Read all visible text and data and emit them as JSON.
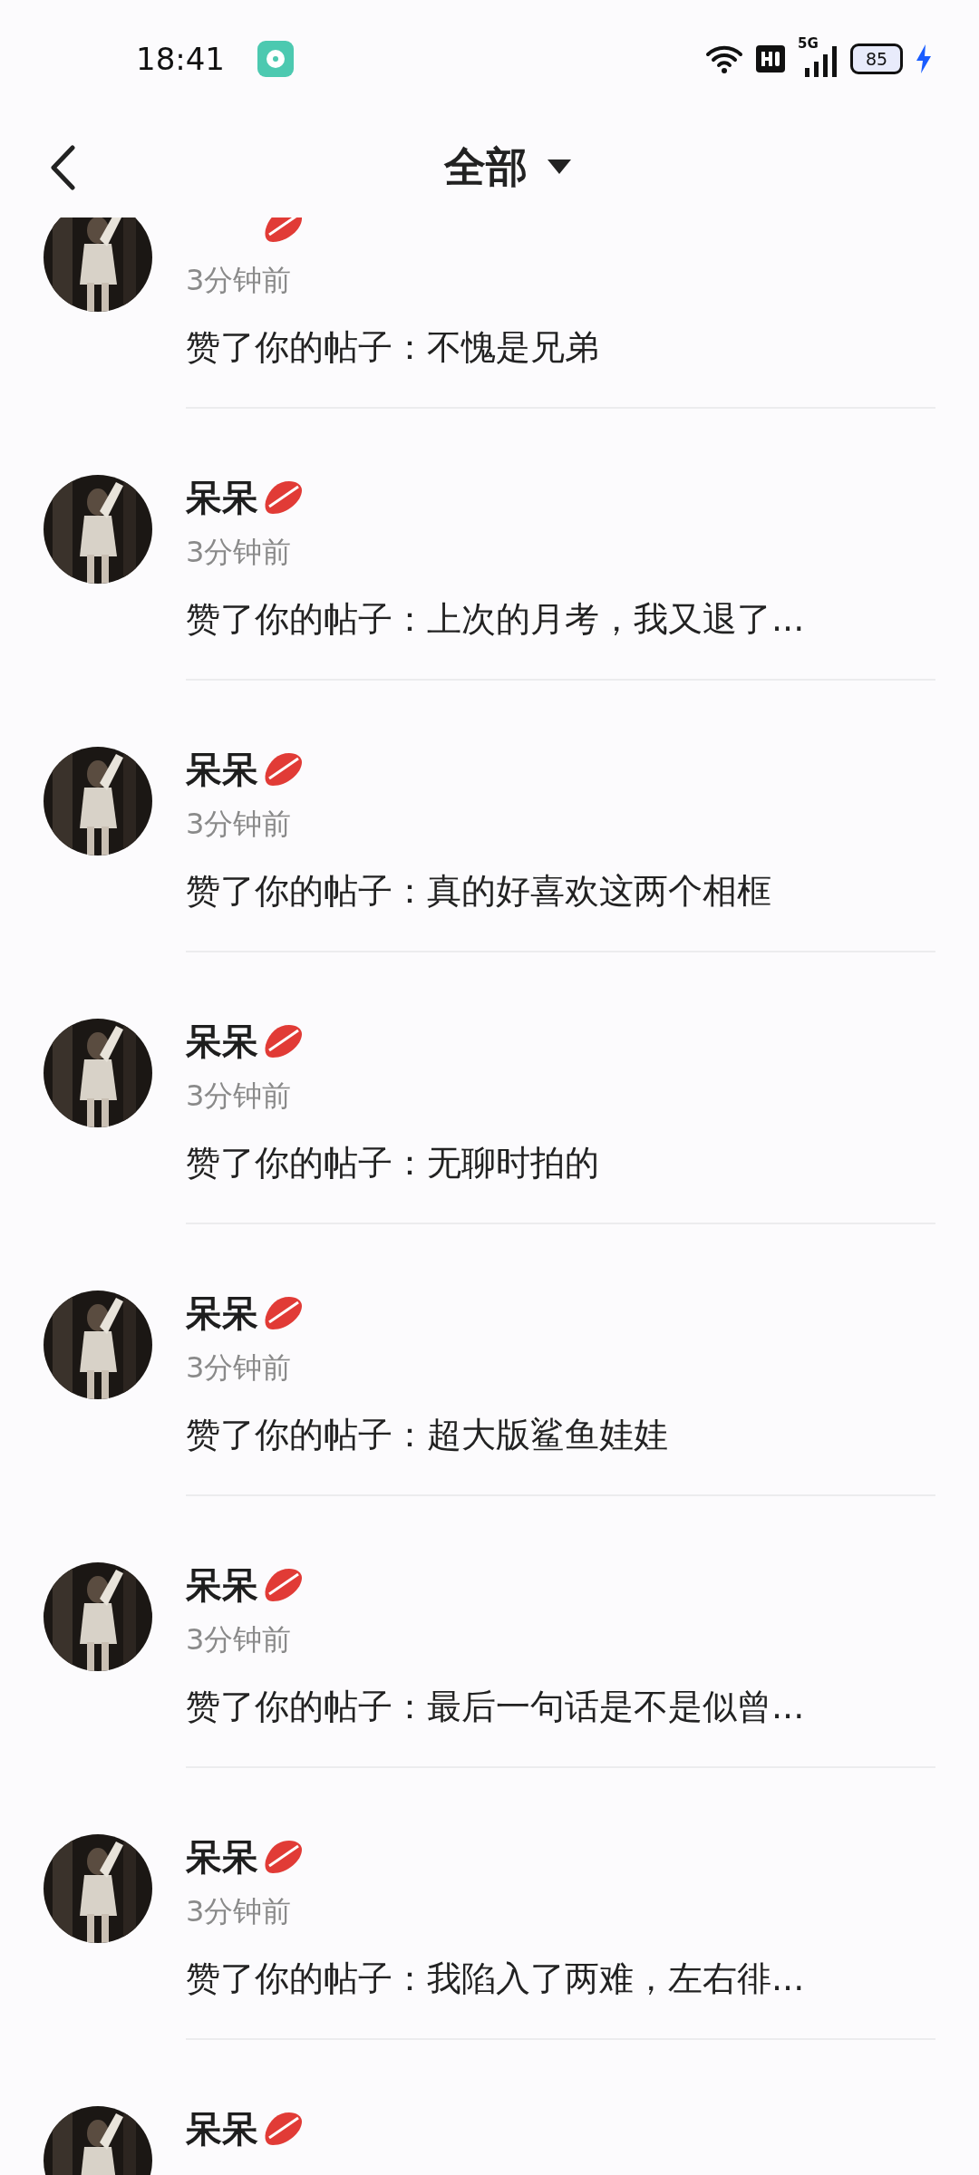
{
  "status_bar": {
    "time": "18:41",
    "network": "5G",
    "battery": "85"
  },
  "header": {
    "title": "全部"
  },
  "notifications": [
    {
      "time": "3分钟前",
      "message": "赞了你的帖子：不愧是兄弟"
    },
    {
      "name": "呆呆",
      "time": "3分钟前",
      "message": "赞了你的帖子：上次的月考，我又退了..."
    },
    {
      "name": "呆呆",
      "time": "3分钟前",
      "message": "赞了你的帖子：真的好喜欢这两个相框"
    },
    {
      "name": "呆呆",
      "time": "3分钟前",
      "message": "赞了你的帖子：无聊时拍的"
    },
    {
      "name": "呆呆",
      "time": "3分钟前",
      "message": "赞了你的帖子：超大版鲨鱼娃娃"
    },
    {
      "name": "呆呆",
      "time": "3分钟前",
      "message": "赞了你的帖子：最后一句话是不是似曾..."
    },
    {
      "name": "呆呆",
      "time": "3分钟前",
      "message": "赞了你的帖子：我陷入了两难，左右徘..."
    },
    {
      "name": "呆呆"
    }
  ]
}
